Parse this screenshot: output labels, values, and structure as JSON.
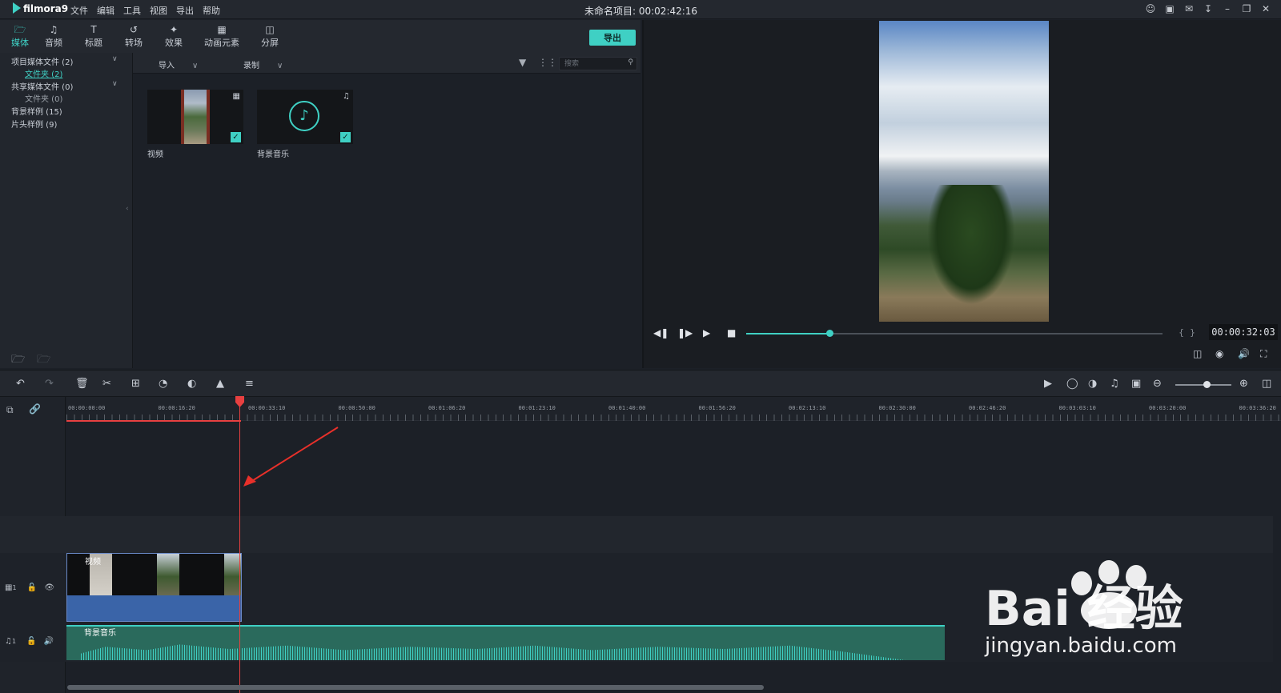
{
  "app": {
    "logo_text": "filmora9",
    "menu": [
      "文件",
      "编辑",
      "工具",
      "视图",
      "导出",
      "帮助"
    ],
    "project_title": "未命名项目: 00:02:42:16"
  },
  "tabs": [
    {
      "label": "媒体",
      "icon": "folder-icon",
      "active": true
    },
    {
      "label": "音频",
      "icon": "music-note-icon",
      "active": false
    },
    {
      "label": "标题",
      "icon": "text-icon",
      "active": false
    },
    {
      "label": "转场",
      "icon": "transition-icon",
      "active": false
    },
    {
      "label": "效果",
      "icon": "effects-icon",
      "active": false
    },
    {
      "label": "动画元素",
      "icon": "elements-icon",
      "active": false
    },
    {
      "label": "分屏",
      "icon": "split-screen-icon",
      "active": false
    }
  ],
  "export_label": "导出",
  "sidebar": {
    "items": [
      {
        "label": "项目媒体文件 (2)",
        "level": 0,
        "expandable": true
      },
      {
        "label": "文件夹 (2)",
        "level": 1,
        "selected": true
      },
      {
        "label": "共享媒体文件 (0)",
        "level": 0,
        "expandable": true
      },
      {
        "label": "文件夹 (0)",
        "level": 1
      },
      {
        "label": "背景样例 (15)",
        "level": 0
      },
      {
        "label": "片头样例 (9)",
        "level": 0
      }
    ]
  },
  "media_toolbar": {
    "import_label": "导入",
    "record_label": "录制",
    "search_placeholder": "搜索"
  },
  "media_items": [
    {
      "label": "视频",
      "type": "video",
      "checked": true
    },
    {
      "label": "背景音乐",
      "type": "audio",
      "checked": true
    }
  ],
  "preview": {
    "timecode": "00:00:32:03",
    "progress": 0.2
  },
  "timeline": {
    "ruler_labels": [
      "00:00:00:00",
      "00:00:16:20",
      "00:00:33:10",
      "00:00:50:00",
      "00:01:06:20",
      "00:01:23:10",
      "00:01:40:00",
      "00:01:56:20",
      "00:02:13:10",
      "00:02:30:00",
      "00:02:46:20",
      "00:03:03:10",
      "00:03:20:00",
      "00:03:36:20"
    ],
    "video_track_label": "1",
    "audio_track_label": "1",
    "video_clip_label": "视频",
    "audio_clip_label": "背景音乐",
    "zoom": 0.55
  },
  "watermark": {
    "brand": "Bai  经验",
    "url": "jingyan.baidu.com"
  },
  "colors": {
    "accent": "#3fd0c4",
    "playhead": "#e84040",
    "video_clip": "#3a64a8",
    "audio_clip": "#2a6a5c"
  }
}
